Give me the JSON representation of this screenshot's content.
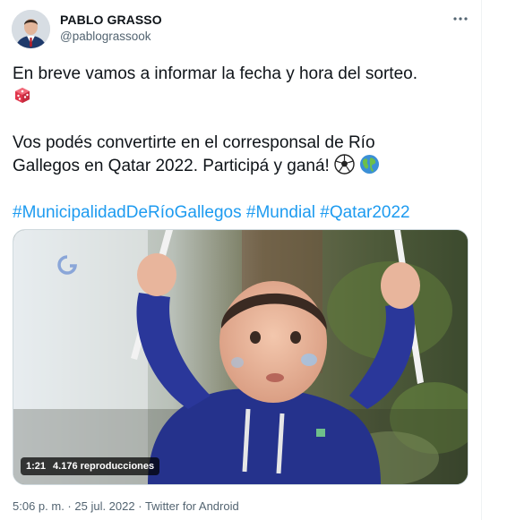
{
  "author": {
    "name": "PABLO GRASSO",
    "handle": "@pablograssook"
  },
  "tweet": {
    "line1": "En breve vamos a informar la fecha y hora del sorteo.",
    "line2": "Vos podés convertirte en el corresponsal de Río",
    "line3": "Gallegos en Qatar 2022. Participá y ganá!",
    "hashtags": [
      "#MunicipalidadDeRíoGallegos",
      "#Mundial",
      "#Qatar2022"
    ]
  },
  "video": {
    "duration": "1:21",
    "views": "4.176 reproducciones"
  },
  "meta": {
    "time": "5:06 p. m.",
    "separator1": " · ",
    "date": "25 jul. 2022",
    "separator2": " · ",
    "source": "Twitter for Android"
  },
  "icons": [
    "dice-icon",
    "soccer-ball-icon",
    "globe-icon",
    "more-icon"
  ],
  "colors": {
    "link": "#1d9bf0",
    "secondary_text": "#536471",
    "text": "#0f1419"
  }
}
